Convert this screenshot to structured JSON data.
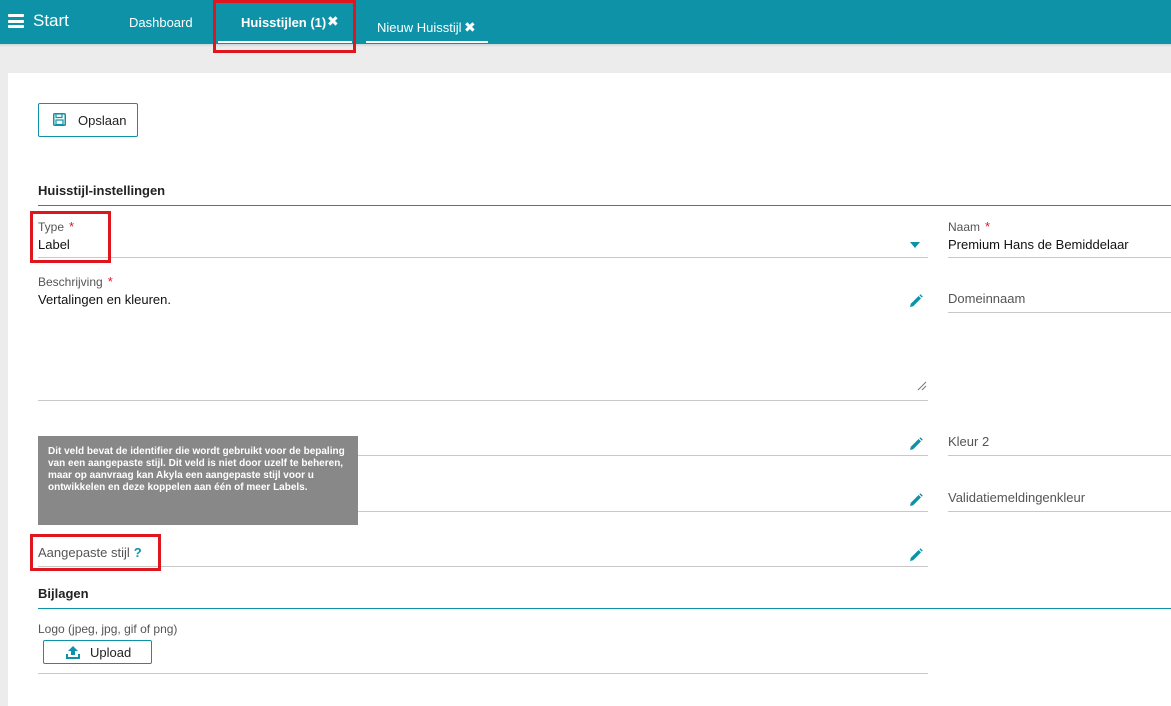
{
  "topbar": {
    "menu_icon": "hamburger-menu-icon",
    "start_label": "Start",
    "tabs": [
      {
        "label": "Dashboard"
      },
      {
        "label": "Huisstijlen (1)",
        "close_icon": "close-icon"
      },
      {
        "label": "Nieuw Huisstijl",
        "close_icon": "close-icon"
      }
    ]
  },
  "toolbar": {
    "save_label": "Opslaan",
    "save_icon": "floppy-disk-icon"
  },
  "sections": {
    "settings_title": "Huisstijl-instellingen",
    "attachments_title": "Bijlagen"
  },
  "fields": {
    "type": {
      "label": "Type",
      "required": "*",
      "value": "Label"
    },
    "naam": {
      "label": "Naam",
      "required": "*",
      "value": "Premium Hans de Bemiddelaar"
    },
    "beschrijving": {
      "label": "Beschrijving",
      "required": "*",
      "value": "Vertalingen en kleuren."
    },
    "domeinnaam": {
      "label": "Domeinnaam"
    },
    "kleur2": {
      "label": "Kleur 2"
    },
    "validatiemeldingenkleur": {
      "label": "Validatiemeldingenkleur"
    },
    "aangepaste_stijl": {
      "label": "Aangepaste stijl",
      "help": "?"
    },
    "logo": {
      "label": "Logo (jpeg, jpg, gif of png)",
      "upload_label": "Upload",
      "upload_icon": "upload-icon"
    }
  },
  "tooltip": {
    "text": "Dit veld bevat de identifier die wordt gebruikt voor de bepaling van een aangepaste stijl. Dit veld is niet door uzelf te beheren, maar op aanvraag kan Akyla een aangepaste stijl voor u ontwikkelen en deze koppelen aan één of meer Labels."
  },
  "colors": {
    "accent": "#0e92a7",
    "highlight": "#e0161e",
    "tooltip_bg": "#888888"
  }
}
